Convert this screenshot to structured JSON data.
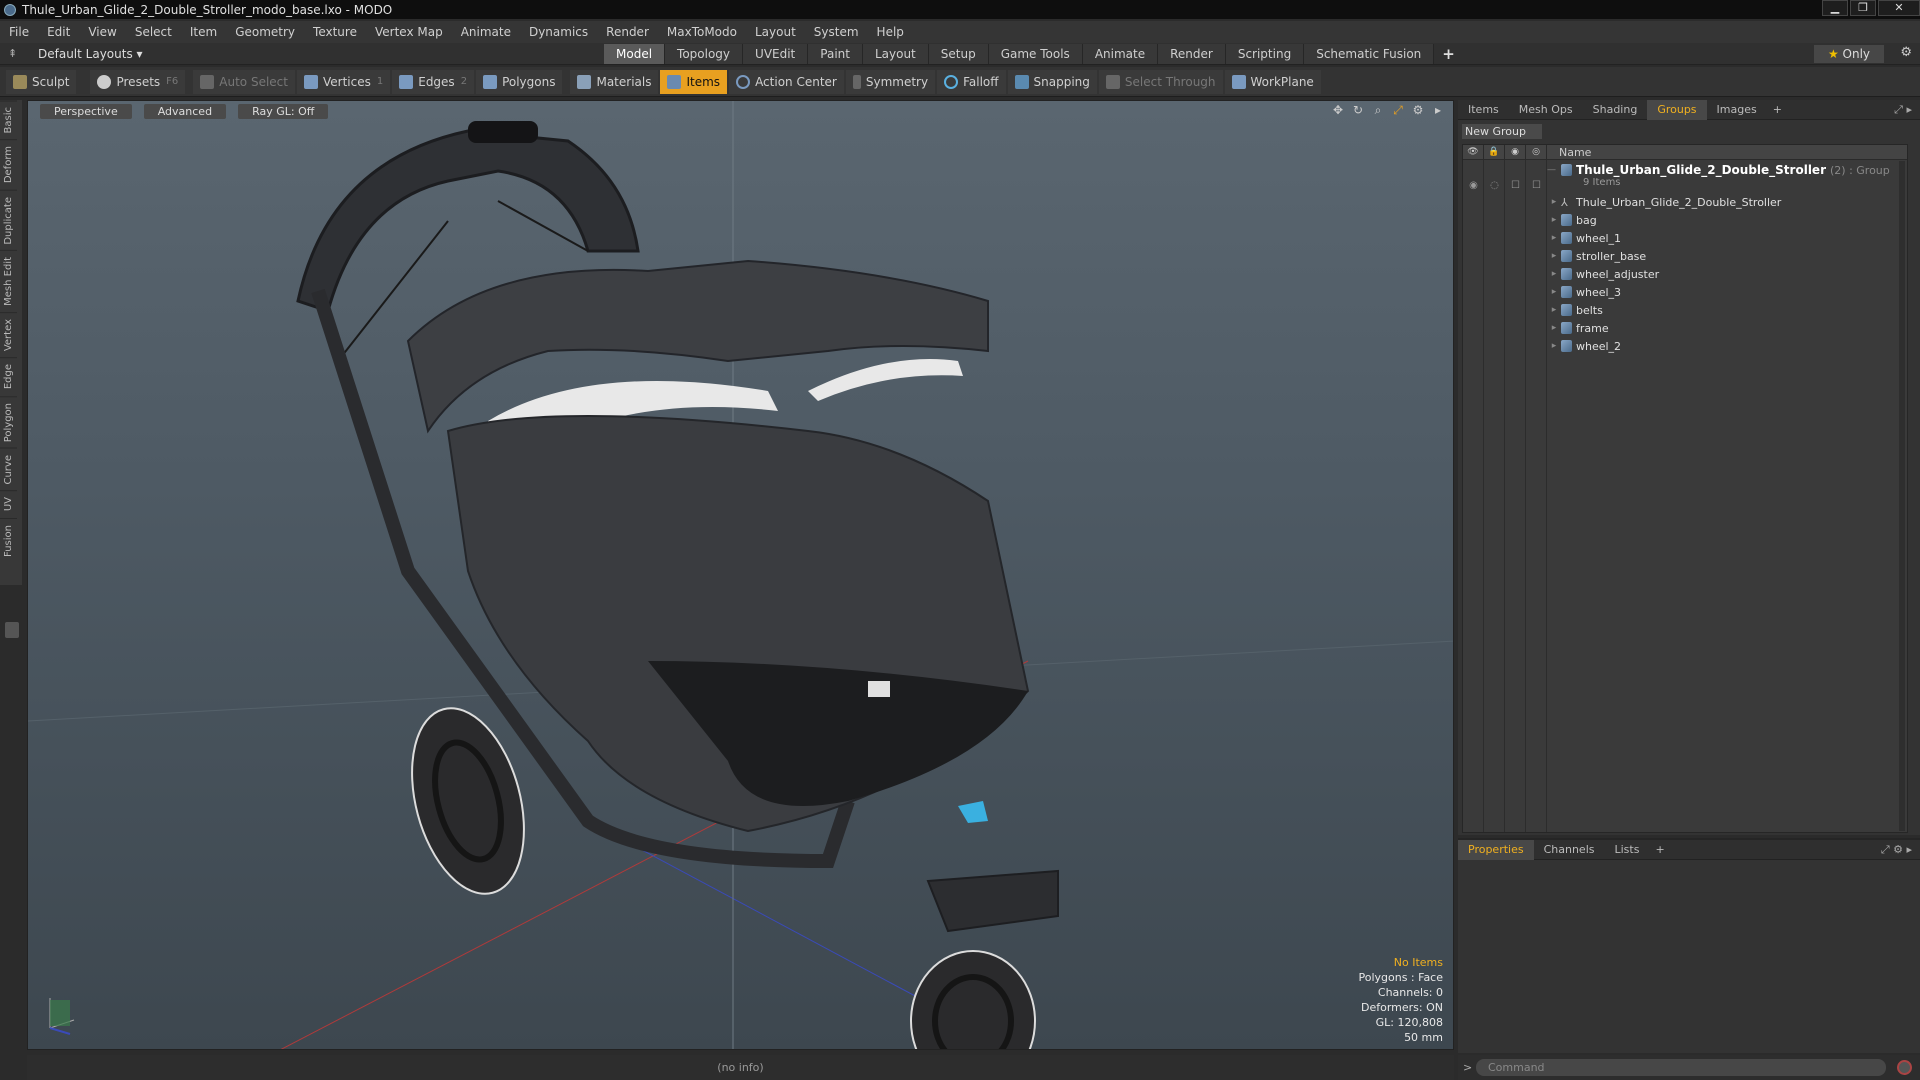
{
  "window": {
    "title": "Thule_Urban_Glide_2_Double_Stroller_modo_base.lxo - MODO",
    "minimize": "▁",
    "maximize": "❐",
    "close": "✕"
  },
  "menu": [
    "File",
    "Edit",
    "View",
    "Select",
    "Item",
    "Geometry",
    "Texture",
    "Vertex Map",
    "Animate",
    "Dynamics",
    "Render",
    "MaxToModo",
    "Layout",
    "System",
    "Help"
  ],
  "layout": {
    "dropdown": "Default Layouts ▾",
    "pin": "⇞"
  },
  "modeTabs": [
    "Model",
    "Topology",
    "UVEdit",
    "Paint",
    "Layout",
    "Setup",
    "Game Tools",
    "Animate",
    "Render",
    "Scripting",
    "Schematic Fusion"
  ],
  "activeModeTab": "Model",
  "addTab": "+",
  "onlyButton": {
    "star": "★",
    "label": "Only"
  },
  "gear": "⚙",
  "toolbar": {
    "sculpt": "Sculpt",
    "presets": "Presets",
    "presetsKey": "F6",
    "autoSelect": "Auto Select",
    "vertices": "Vertices",
    "verticesKey": "1",
    "edges": "Edges",
    "edgesKey": "2",
    "polygons": "Polygons",
    "materials": "Materials",
    "items": "Items",
    "actionCenter": "Action Center",
    "symmetry": "Symmetry",
    "falloff": "Falloff",
    "snapping": "Snapping",
    "selectThrough": "Select Through",
    "workplane": "WorkPlane"
  },
  "leftTabs": [
    "Basic",
    "Deform",
    "Duplicate",
    "Mesh Edit",
    "Vertex",
    "Edge",
    "Polygon",
    "Curve",
    "UV",
    "Fusion"
  ],
  "viewport": {
    "view": "Perspective",
    "shading": "Advanced",
    "render": "Ray GL: Off",
    "stats": [
      "No Items",
      "Polygons : Face",
      "Channels: 0",
      "Deformers: ON",
      "GL: 120,808",
      "50 mm"
    ]
  },
  "status": "(no info)",
  "rightTabs": [
    "Items",
    "Mesh Ops",
    "Shading",
    "Groups",
    "Images"
  ],
  "activeRightTab": "Groups",
  "newGroup": "New Group",
  "list": {
    "header": "Name",
    "group": {
      "name": "Thule_Urban_Glide_2_Double_Stroller",
      "type": "(2) : Group",
      "count": "9 Items"
    },
    "items": [
      {
        "name": "Thule_Urban_Glide_2_Double_Stroller",
        "icon": "locator-icon"
      },
      {
        "name": "bag",
        "icon": "mesh-icon"
      },
      {
        "name": "wheel_1",
        "icon": "mesh-icon"
      },
      {
        "name": "stroller_base",
        "icon": "mesh-icon"
      },
      {
        "name": "wheel_adjuster",
        "icon": "mesh-icon"
      },
      {
        "name": "wheel_3",
        "icon": "mesh-icon"
      },
      {
        "name": "belts",
        "icon": "mesh-icon"
      },
      {
        "name": "frame",
        "icon": "mesh-icon"
      },
      {
        "name": "wheel_2",
        "icon": "mesh-icon"
      }
    ]
  },
  "propTabs": [
    "Properties",
    "Channels",
    "Lists"
  ],
  "activePropTab": "Properties",
  "command": {
    "placeholder": "Command",
    "arrow": ">"
  },
  "colors": {
    "accent": "#e8a020",
    "highlightTab": "#f0b020"
  }
}
